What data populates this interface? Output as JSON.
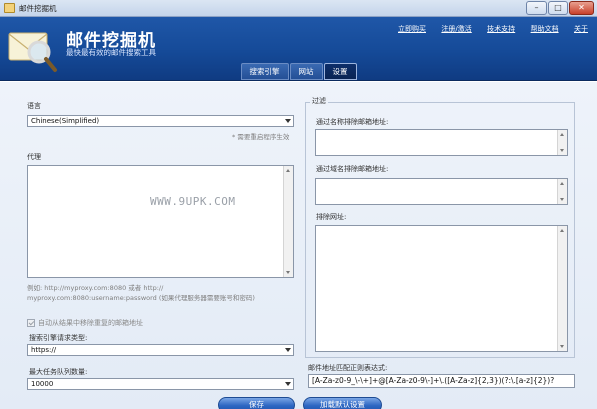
{
  "window": {
    "title": "邮件挖掘机"
  },
  "header": {
    "app_name": "邮件挖掘机",
    "tagline": "最快最有效的邮件搜索工具",
    "links": [
      "立即购买",
      "注册/激活",
      "技术支持",
      "帮助文档",
      "关于"
    ]
  },
  "tabs": [
    {
      "label": "搜索引擎",
      "active": false
    },
    {
      "label": "网站",
      "active": false
    },
    {
      "label": "设置",
      "active": true
    }
  ],
  "settings": {
    "language_label": "语言",
    "language_value": "Chinese(Simplified)",
    "restart_note": "* 需要重启程序生效",
    "proxy_label": "代理",
    "proxy_value": "",
    "watermark": "WWW.9UPK.COM",
    "proxy_example": "例如: http://myproxy.com:8080 或者 http://myproxy.com:8080:username:password (如果代理服务器需要账号和密码)",
    "proxy_example_line1": "例如: http://myproxy.com:8080 或者 http://",
    "proxy_example_line2": "myproxy.com:8080:username:password (如果代理服务器需要账号和密码)",
    "auto_remove_label": "自动从结果中移除重复的邮箱地址",
    "auto_remove_checked": true,
    "request_type_label": "搜索引擎请求类型:",
    "request_type_value": "https://",
    "max_tasks_label": "最大任务队列数量:",
    "max_tasks_value": "10000"
  },
  "filter": {
    "legend": "过滤",
    "exclude_by_name_label": "通过名称排除邮箱地址:",
    "exclude_by_domain_label": "通过域名排除邮箱地址:",
    "exclude_urls_label": "排除网址:",
    "regex_label": "邮件地址匹配正则表达式:",
    "regex_value": "[A-Za-z0-9_\\-\\+]+@[A-Za-z0-9\\-]+\\.([A-Za-z]{2,3})(?:\\.[a-z]{2})?"
  },
  "buttons": {
    "save": "保存",
    "load_defaults": "加载默认设置"
  },
  "colors": {
    "header_blue": "#1f57a8",
    "tab_active": "#0c2e6a",
    "content_bg": "#eef3fa"
  }
}
